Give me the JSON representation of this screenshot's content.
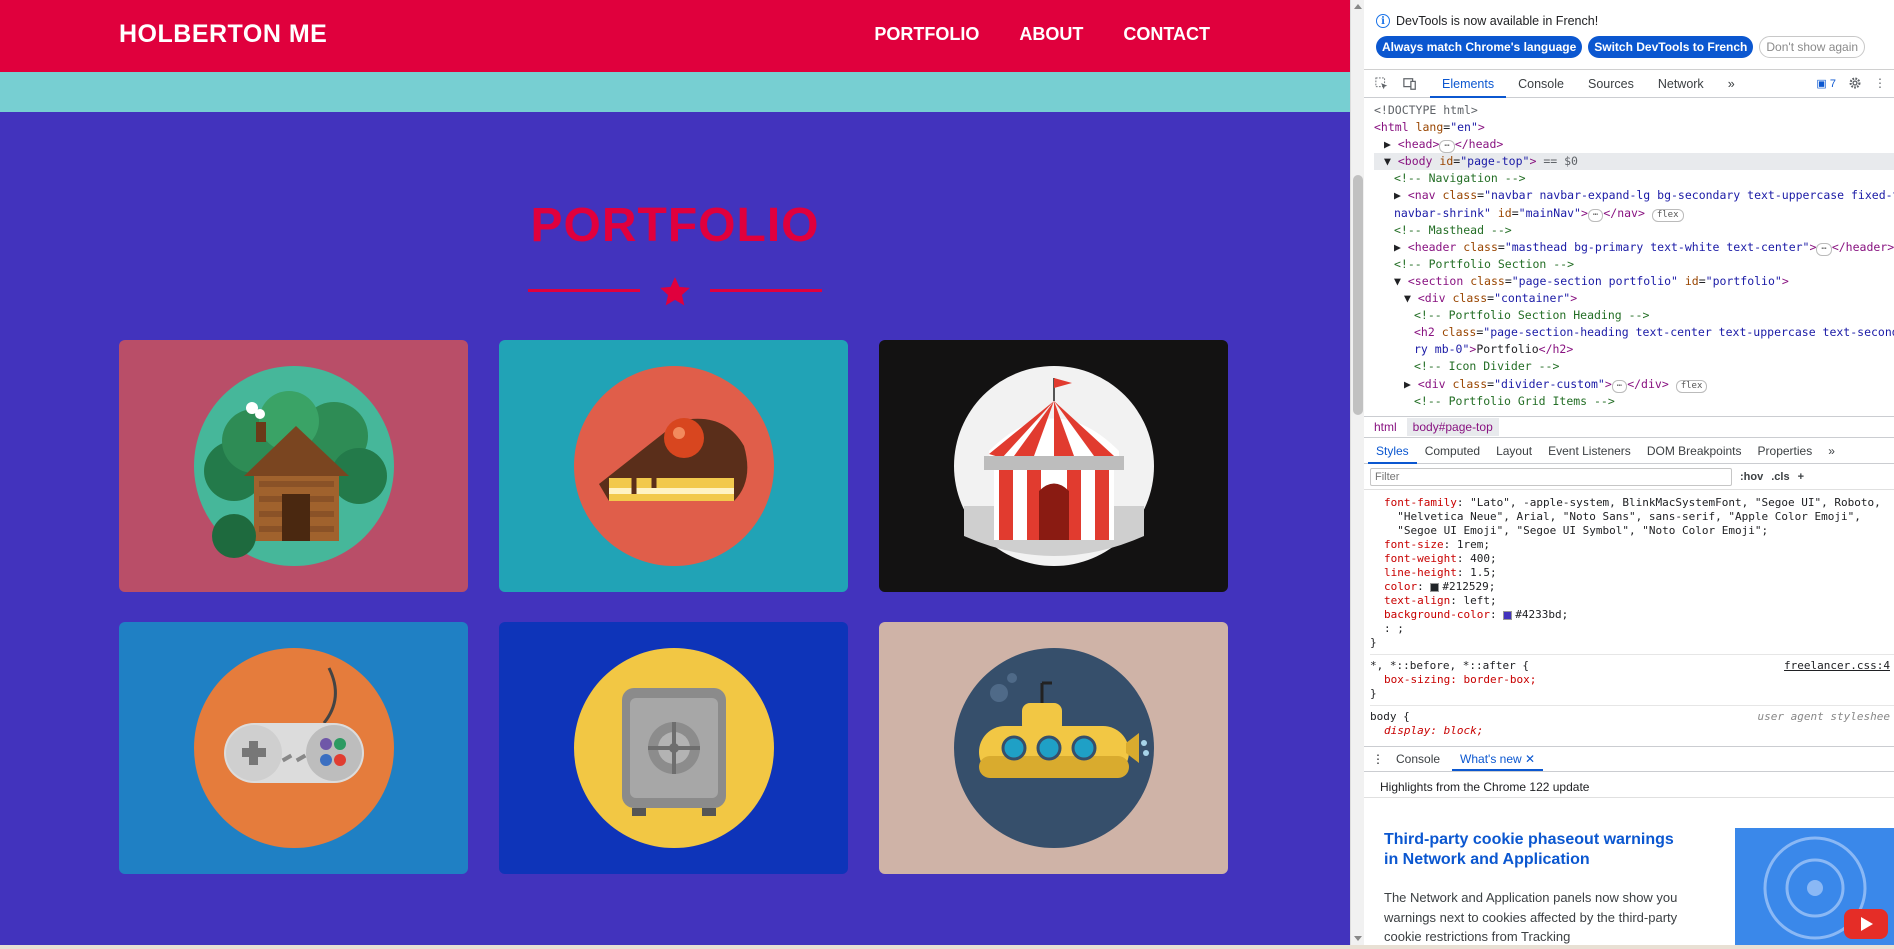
{
  "site": {
    "brand": "HOLBERTON ME",
    "nav": [
      "PORTFOLIO",
      "ABOUT",
      "CONTACT"
    ],
    "section_title": "PORTFOLIO",
    "portfolio_items": [
      {
        "icon": "cabin-icon",
        "bg": "#b94e68"
      },
      {
        "icon": "cake-icon",
        "bg": "#21a3b6"
      },
      {
        "icon": "circus-tent-icon",
        "bg": "#131212"
      },
      {
        "icon": "game-controller-icon",
        "bg": "#1f80c4"
      },
      {
        "icon": "safe-icon",
        "bg": "#0e34b9"
      },
      {
        "icon": "submarine-icon",
        "bg": "#cfb3a7"
      }
    ],
    "colors": {
      "primary": "#e0003d",
      "background": "#4233bd",
      "masthead": "#77cfd2"
    }
  },
  "devtools": {
    "notice": "DevTools is now available in French!",
    "notice_buttons": [
      "Always match Chrome's language",
      "Switch DevTools to French",
      "Don't show again"
    ],
    "tabs": [
      "Elements",
      "Console",
      "Sources",
      "Network"
    ],
    "more_tabs": "»",
    "issues_count": "7",
    "dom_lines": [
      {
        "indent": 0,
        "html": "<span class='dim'>&lt;!DOCTYPE html&gt;</span>"
      },
      {
        "indent": 0,
        "html": "<span class='tag'>&lt;html</span> <span class='attr'>lang</span>=<span class='val'>\"en\"</span><span class='tag'>&gt;</span>"
      },
      {
        "indent": 1,
        "html": "▶ <span class='tag'>&lt;head&gt;</span><span class='chip'>⋯</span><span class='tag'>&lt;/head&gt;</span>"
      },
      {
        "indent": 1,
        "sel": true,
        "html": "▼ <span class='tag'>&lt;body</span> <span class='attr'>id</span>=<span class='val'>\"page-top\"</span><span class='tag'>&gt;</span> <span class='dim'>== $0</span>"
      },
      {
        "indent": 2,
        "html": "<span class='cmt'>&lt;!-- Navigation --&gt;</span>"
      },
      {
        "indent": 2,
        "html": "▶ <span class='tag'>&lt;nav</span> <span class='attr'>class</span>=<span class='val'>\"navbar navbar-expand-lg bg-secondary text-uppercase fixed-top</span>"
      },
      {
        "indent": 2,
        "html": "<span class='val'>navbar-shrink\"</span> <span class='attr'>id</span>=<span class='val'>\"mainNav\"</span><span class='tag'>&gt;</span><span class='chip'>⋯</span><span class='tag'>&lt;/nav&gt;</span> <span class='chip'>flex</span>"
      },
      {
        "indent": 2,
        "html": "<span class='cmt'>&lt;!-- Masthead --&gt;</span>"
      },
      {
        "indent": 2,
        "html": "▶ <span class='tag'>&lt;header</span> <span class='attr'>class</span>=<span class='val'>\"masthead bg-primary text-white text-center\"</span><span class='tag'>&gt;</span><span class='chip'>⋯</span><span class='tag'>&lt;/header&gt;</span>"
      },
      {
        "indent": 2,
        "html": "<span class='cmt'>&lt;!-- Portfolio Section --&gt;</span>"
      },
      {
        "indent": 2,
        "html": "▼ <span class='tag'>&lt;section</span> <span class='attr'>class</span>=<span class='val'>\"page-section portfolio\"</span> <span class='attr'>id</span>=<span class='val'>\"portfolio\"</span><span class='tag'>&gt;</span>"
      },
      {
        "indent": 3,
        "html": "▼ <span class='tag'>&lt;div</span> <span class='attr'>class</span>=<span class='val'>\"container\"</span><span class='tag'>&gt;</span>"
      },
      {
        "indent": 4,
        "html": "<span class='cmt'>&lt;!-- Portfolio Section Heading --&gt;</span>"
      },
      {
        "indent": 4,
        "html": "<span class='tag'>&lt;h2</span> <span class='attr'>class</span>=<span class='val'>\"page-section-heading text-center text-uppercase text-second</span>"
      },
      {
        "indent": 4,
        "html": "<span class='val'>ry mb-0\"</span><span class='tag'>&gt;</span>Portfolio<span class='tag'>&lt;/h2&gt;</span>"
      },
      {
        "indent": 4,
        "html": "<span class='cmt'>&lt;!-- Icon Divider --&gt;</span>"
      },
      {
        "indent": 3,
        "html": "▶ <span class='tag'>&lt;div</span> <span class='attr'>class</span>=<span class='val'>\"divider-custom\"</span><span class='tag'>&gt;</span><span class='chip'>⋯</span><span class='tag'>&lt;/div&gt;</span> <span class='chip'>flex</span>"
      },
      {
        "indent": 4,
        "html": "<span class='cmt'>&lt;!-- Portfolio Grid Items --&gt;</span>"
      }
    ],
    "breadcrumbs": [
      "html",
      "body#page-top"
    ],
    "styles_tabs": [
      "Styles",
      "Computed",
      "Layout",
      "Event Listeners",
      "DOM Breakpoints",
      "Properties"
    ],
    "filter_placeholder": "Filter",
    "filter_tools": [
      ":hov",
      ".cls"
    ],
    "css_lines": [
      "<span class='prop'>font-family</span>: <span class='pval'>\"Lato\", -apple-system, BlinkMacSystemFont, \"Segoe UI\", Roboto,</span>",
      "<span class='pval'>&nbsp;&nbsp;\"Helvetica Neue\", Arial, \"Noto Sans\", sans-serif, \"Apple Color Emoji\",</span>",
      "<span class='pval'>&nbsp;&nbsp;\"Segoe UI Emoji\", \"Segoe UI Symbol\", \"Noto Color Emoji\";</span>",
      "<span class='prop'>font-size</span>: <span class='pval'>1rem;</span>",
      "<span class='prop'>font-weight</span>: <span class='pval'>400;</span>",
      "<span class='prop'>line-height</span>: <span class='pval'>1.5;</span>",
      "<span class='prop'>color</span>: <span class='swatch' style='background:#212529'></span><span class='pval'>#212529;</span>",
      "<span class='prop'>text-align</span>: <span class='pval'>left;</span>",
      "<span class='prop'>background-color</span>: <span class='swatch' style='background:#4233bd'></span><span class='pval'>#4233bd;</span>",
      "<span class='pval'>: ;</span>"
    ],
    "rule2_selector": "*, *::before, *::after {",
    "rule2_source": "freelancer.css:4",
    "rule2_prop": "box-sizing: border-box;",
    "rule3_selector": "body {",
    "rule3_source": "user agent styleshee",
    "rule3_prop": "display: block;",
    "drawer_tabs": [
      "Console",
      "What's new"
    ],
    "highlights": "Highlights from the Chrome 122 update",
    "whats_new_title": "Third-party cookie phaseout warnings in Network and Application",
    "whats_new_body": "The Network and Application panels now show you warnings next to cookies affected by the third-party cookie restrictions from Tracking"
  }
}
